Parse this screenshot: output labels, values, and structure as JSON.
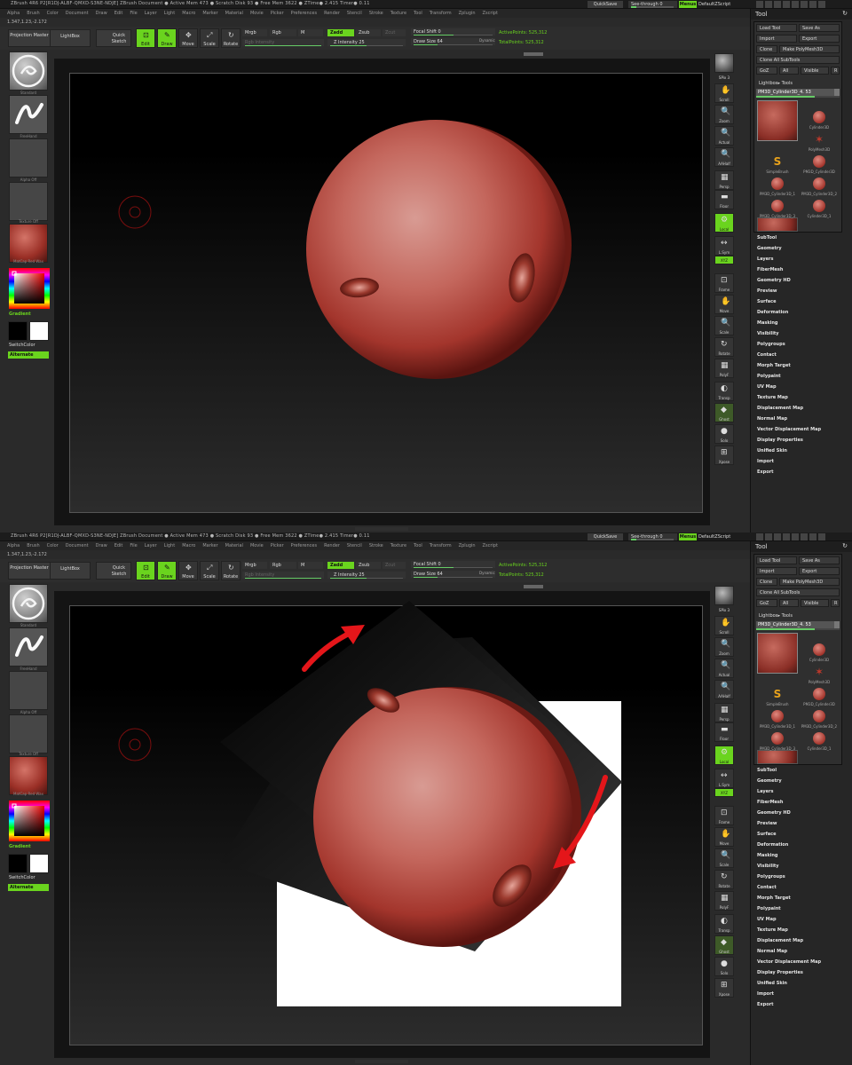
{
  "title_bar": {
    "title": "ZBrush 4R6 P2[R1DJ-ALBF-QMXD-S3NE-NDJE]    ZBrush Document      ● Active Mem 473  ● Scratch Disk 93  ● Free Mem 3622  ● ZTime● 2.415  Timer● 0.11",
    "quicksave": "QuickSave",
    "see_through": "See-through   0",
    "menus": "Menus",
    "default_zscript": "DefaultZScript"
  },
  "menu_bar": [
    "Alpha",
    "Brush",
    "Color",
    "Document",
    "Draw",
    "Edit",
    "File",
    "Layer",
    "Light",
    "Macro",
    "Marker",
    "Material",
    "Movie",
    "Picker",
    "Preferences",
    "Render",
    "Stencil",
    "Stroke",
    "Texture",
    "Tool",
    "Transform",
    "Zplugin",
    "Zscript"
  ],
  "coords": "1.347,1.23,-2.172",
  "top_shelf": {
    "projection_master": "Projection Master",
    "lightbox": "LightBox",
    "quick_sketch": "Quick Sketch",
    "edit": "Edit",
    "draw": "Draw",
    "move": "Move",
    "scale": "Scale",
    "rotate": "Rotate",
    "mrgb": "Mrgb",
    "rgb": "Rgb",
    "m": "M",
    "rgb_intensity": "Rgb Intensity",
    "zadd": "Zadd",
    "zsub": "Zsub",
    "zcut": "Zcut",
    "z_intensity": "Z Intensity 25",
    "focal_shift": "Focal Shift 0",
    "draw_size": "Draw Size 64",
    "dynamic": "Dynamic",
    "active_points": "ActivePoints: 525,312",
    "total_points": "TotalPoints: 525,312"
  },
  "left_shelf": {
    "brush_label": "Standard",
    "stroke_label": "FreeHand",
    "alpha_label": "Alpha Off",
    "texture_label": "Texture Off",
    "material_label": "MatCap Red Wax",
    "gradient": "Gradient",
    "switch_color": "SwitchColor",
    "alternate": "Alternate"
  },
  "right_shelf": [
    {
      "name": "bpr",
      "label": "",
      "icon": "sphere"
    },
    {
      "name": "spix",
      "label": "SPix 3",
      "icon": ""
    },
    {
      "name": "scroll",
      "label": "Scroll",
      "icon": "✋"
    },
    {
      "name": "zoom",
      "label": "Zoom",
      "icon": "🔍"
    },
    {
      "name": "actual",
      "label": "Actual",
      "icon": "🔍"
    },
    {
      "name": "aahalf",
      "label": "AAHalf",
      "icon": "🔍"
    },
    {
      "name": "persp",
      "label": "Persp",
      "icon": "▦"
    },
    {
      "name": "floor",
      "label": "Floor",
      "icon": "▬"
    },
    {
      "name": "local",
      "label": "Local",
      "icon": "⚙"
    },
    {
      "name": "lsym",
      "label": "L.Sym",
      "icon": "↔"
    },
    {
      "name": "xyz",
      "label": "XYZ",
      "icon": ""
    },
    {
      "name": "frame",
      "label": "Frame",
      "icon": "⊡"
    },
    {
      "name": "move",
      "label": "Move",
      "icon": "✋"
    },
    {
      "name": "scale",
      "label": "Scale",
      "icon": "🔍"
    },
    {
      "name": "rotate",
      "label": "Rotate",
      "icon": "↻"
    },
    {
      "name": "polyf",
      "label": "PolyF",
      "icon": "▦"
    },
    {
      "name": "transp",
      "label": "Transp",
      "icon": "◐"
    },
    {
      "name": "ghost",
      "label": "Ghost",
      "icon": "◆"
    },
    {
      "name": "solo",
      "label": "Solo",
      "icon": "●"
    },
    {
      "name": "xpose",
      "label": "Xpose",
      "icon": "⊞"
    }
  ],
  "tool_panel": {
    "title": "Tool",
    "load_tool": "Load Tool",
    "save_as": "Save As",
    "import": "Import",
    "export": "Export",
    "clone": "Clone",
    "make_polymesh": "Make PolyMesh3D",
    "clone_all": "Clone  All SubTools",
    "goz": "GoZ",
    "all": "All",
    "visible": "Visible",
    "r": "R",
    "lightbox_tools": "Lightbox▸ Tools",
    "current_tool": "PM3D_Cylinder3D_4. 53",
    "items": [
      {
        "name": "Cylinder3D"
      },
      {
        "name": "PolyMesh3D"
      },
      {
        "name": "SimpleBrush"
      },
      {
        "name": "PM3D_Cylinder3D"
      },
      {
        "name": "PM3D_Cylinder3D_1"
      },
      {
        "name": "PM3D_Cylinder3D_2"
      },
      {
        "name": "PM3D_Cylinder3D_3"
      },
      {
        "name": "Cylinder3D_1"
      }
    ],
    "palettes": [
      "SubTool",
      "Geometry",
      "Layers",
      "FiberMesh",
      "Geometry HD",
      "Preview",
      "Surface",
      "Deformation",
      "Masking",
      "Visibility",
      "Polygroups",
      "Contact",
      "Morph Target",
      "Polypaint",
      "UV Map",
      "Texture Map",
      "Displacement Map",
      "Normal Map",
      "Vector Displacement Map",
      "Display Properties",
      "Unified Skin",
      "Import",
      "Export"
    ]
  },
  "colors": {
    "accent": "#6ad41e",
    "mesh": "#a3352c",
    "arrow": "#e4161a"
  }
}
